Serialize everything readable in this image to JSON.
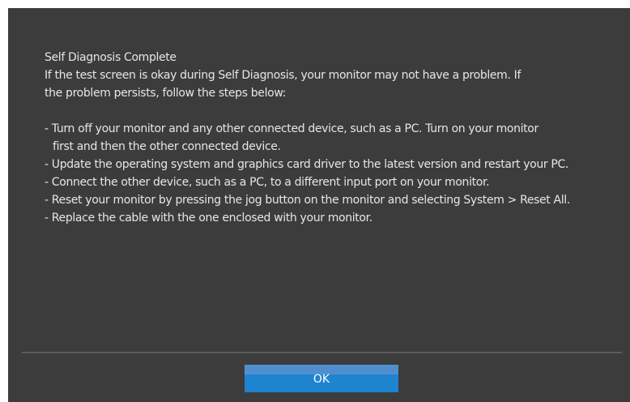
{
  "dialog": {
    "title": "Self Diagnosis Complete",
    "message_line1": "If the test screen is okay during Self Diagnosis, your monitor may not have a  problem. If",
    "message_line2": "the problem persists, follow the  steps below:",
    "steps": {
      "step1_line1": "- Turn off your monitor and any other connected device, such as a PC. Turn on your monitor",
      "step1_line2": "first and then the other connected device.",
      "step2": "- Update the operating system and graphics card driver to the latest version and restart your PC.",
      "step3": "- Connect the other device, such as a PC, to a different input port on your monitor.",
      "step4": "- Reset your monitor by pressing the jog button on the monitor and selecting System > Reset All.",
      "step5": "- Replace the cable with the one enclosed with your monitor."
    },
    "ok_label": "OK"
  },
  "colors": {
    "dialog_background": "#3c3c3c",
    "text": "#e6e6e6",
    "divider": "#5c5c5c",
    "button": "#1e84d0",
    "button_highlight": "#4f8fcf"
  }
}
